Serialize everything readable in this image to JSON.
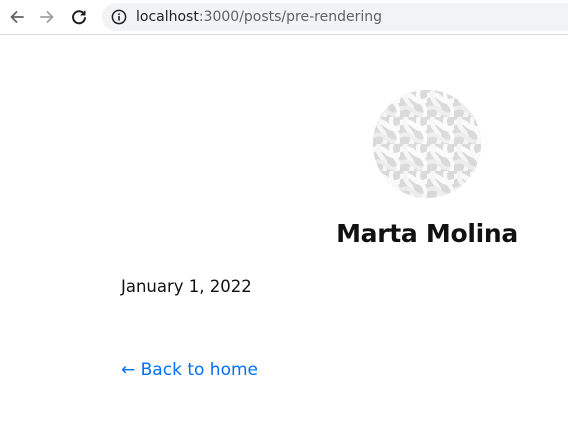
{
  "browser": {
    "url_host": "localhost",
    "url_path": ":3000/posts/pre-rendering",
    "icons": {
      "back": "arrow-left-icon",
      "forward": "arrow-right-icon",
      "reload": "reload-icon",
      "site_info": "info-icon"
    }
  },
  "profile": {
    "name": "Marta Molina",
    "avatar_icon": "profile-image"
  },
  "post": {
    "date": "January 1, 2022"
  },
  "footer": {
    "back_link": "← Back to home"
  },
  "colors": {
    "link": "#0070f3",
    "text": "#111111",
    "omnibox": "#f1f3f4"
  }
}
